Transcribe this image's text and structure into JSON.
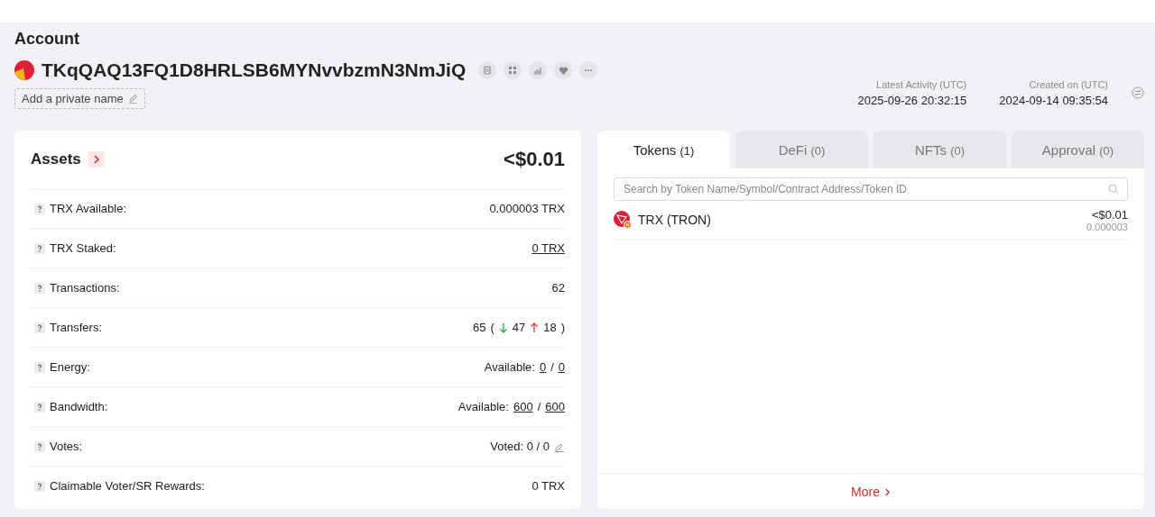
{
  "page_title": "Account",
  "address": "TKqQAQ13FQ1D8HRLSB6MYNvvbzmN3NmJiQ",
  "private_name_button": "Add a private name",
  "dates": [
    {
      "label": "Latest Activity (UTC)",
      "value": "2025-09-26 20:32:15"
    },
    {
      "label": "Created on (UTC)",
      "value": "2024-09-14 09:35:54"
    }
  ],
  "assets": {
    "title": "Assets",
    "total": "<$0.01",
    "rows": [
      {
        "label": "TRX Available:",
        "value": [
          {
            "kind": "text",
            "text": "0.000003 TRX"
          }
        ]
      },
      {
        "label": "TRX Staked:",
        "value": [
          {
            "kind": "link",
            "text": "0 TRX"
          }
        ]
      },
      {
        "label": "Transactions:",
        "value": [
          {
            "kind": "text",
            "text": "62"
          }
        ]
      },
      {
        "label": "Transfers:",
        "value": [
          {
            "kind": "text",
            "text": "65"
          },
          {
            "kind": "text",
            "text": "("
          },
          {
            "kind": "in"
          },
          {
            "kind": "text",
            "text": "47"
          },
          {
            "kind": "out"
          },
          {
            "kind": "text",
            "text": "18"
          },
          {
            "kind": "text",
            "text": ")"
          }
        ]
      },
      {
        "label": "Energy:",
        "value": [
          {
            "kind": "text",
            "text": "Available:"
          },
          {
            "kind": "link",
            "text": "0"
          },
          {
            "kind": "text",
            "text": "/"
          },
          {
            "kind": "link",
            "text": "0"
          }
        ]
      },
      {
        "label": "Bandwidth:",
        "value": [
          {
            "kind": "text",
            "text": "Available:"
          },
          {
            "kind": "link",
            "text": "600"
          },
          {
            "kind": "text",
            "text": "/"
          },
          {
            "kind": "link",
            "text": "600"
          }
        ]
      },
      {
        "label": "Votes:",
        "value": [
          {
            "kind": "text",
            "text": "Voted: 0 / 0"
          },
          {
            "kind": "edit"
          }
        ]
      },
      {
        "label": "Claimable Voter/SR Rewards:",
        "value": [
          {
            "kind": "text",
            "text": "0 TRX"
          }
        ]
      }
    ]
  },
  "tabs": [
    {
      "label": "Tokens",
      "count": "(1)",
      "selected": true
    },
    {
      "label": "DeFi",
      "count": "(0)",
      "selected": false
    },
    {
      "label": "NFTs",
      "count": "(0)",
      "selected": false
    },
    {
      "label": "Approval",
      "count": "(0)",
      "selected": false
    }
  ],
  "search": {
    "placeholder": "Search by Token Name/Symbol/Contract Address/Token ID"
  },
  "tokens": [
    {
      "name": "TRX (TRON)",
      "value": "<$0.01",
      "amount": "0.000003"
    }
  ],
  "more_link": "More"
}
